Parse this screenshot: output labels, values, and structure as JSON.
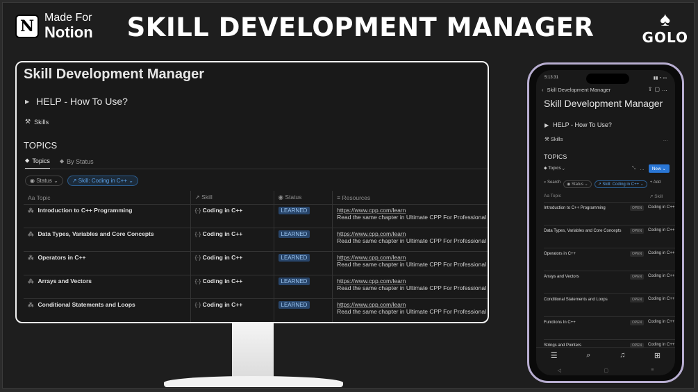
{
  "header": {
    "brand_made": "Made For",
    "brand_name": "Notion",
    "title": "SKILL DEVELOPMENT MANAGER",
    "logo_text": "GOLO",
    "logo_icon": "spade-icon"
  },
  "desktop": {
    "page_title": "Skill Development Manager",
    "help_toggle": "HELP - How To Use?",
    "skills_link": "Skills",
    "topics_heading": "TOPICS",
    "tabs": [
      {
        "label": "Topics",
        "icon": "tag-icon"
      },
      {
        "label": "By Status",
        "icon": "tag-icon"
      }
    ],
    "filters": [
      "Status",
      "Skill: Coding in C++"
    ],
    "columns": [
      "Topic",
      "Skill",
      "Status",
      "Resources"
    ],
    "rows": [
      {
        "topic": "Introduction to C++ Programming",
        "skill": "Coding in C++",
        "status": "LEARNED",
        "url": "https://www.cpp.com/learn",
        "note": "Read the same chapter in Ultimate CPP For Professional B"
      },
      {
        "topic": "Data Types, Variables and Core Concepts",
        "skill": "Coding in C++",
        "status": "LEARNED",
        "url": "https://www.cpp.com/learn",
        "note": "Read the same chapter in Ultimate CPP For Professional B"
      },
      {
        "topic": "Operators in C++",
        "skill": "Coding in C++",
        "status": "LEARNED",
        "url": "https://www.cpp.com/learn",
        "note": "Read the same chapter in Ultimate CPP For Professional B"
      },
      {
        "topic": "Arrays and Vectors",
        "skill": "Coding in C++",
        "status": "LEARNED",
        "url": "https://www.cpp.com/learn",
        "note": "Read the same chapter in Ultimate CPP For Professional B"
      },
      {
        "topic": "Conditional Statements and Loops",
        "skill": "Coding in C++",
        "status": "LEARNED",
        "url": "https://www.cpp.com/learn",
        "note": "Read the same chapter in Ultimate CPP For Professional B"
      }
    ]
  },
  "mobile": {
    "time": "5:13:31",
    "status_right": "▮▮ ◔ ▭",
    "nav_title": "Skill Development Manager",
    "page_title": "Skill Development Manager",
    "help_toggle": "HELP - How To Use?",
    "skills_link": "Skills",
    "topics_heading": "TOPICS",
    "tab_label": "Topics",
    "new_button": "New",
    "filters": [
      "Search",
      "Status",
      "Skill: Coding in C++"
    ],
    "extra_filter": "+ Add",
    "columns": [
      "Topic",
      "Skill"
    ],
    "open_label": "OPEN",
    "rows": [
      {
        "topic": "Introduction to C++ Programming",
        "skill": "Coding in C++"
      },
      {
        "topic": "Data Types, Variables and Core Concepts",
        "skill": "Coding in C++"
      },
      {
        "topic": "Operators in C++",
        "skill": "Coding in C++"
      },
      {
        "topic": "Arrays and Vectors",
        "skill": "Coding in C++"
      },
      {
        "topic": "Conditional Statements and Loops",
        "skill": "Coding in C++"
      },
      {
        "topic": "Functions In C++",
        "skill": "Coding in C++"
      },
      {
        "topic": "Strings and Pointers",
        "skill": "Coding in C++"
      }
    ]
  }
}
